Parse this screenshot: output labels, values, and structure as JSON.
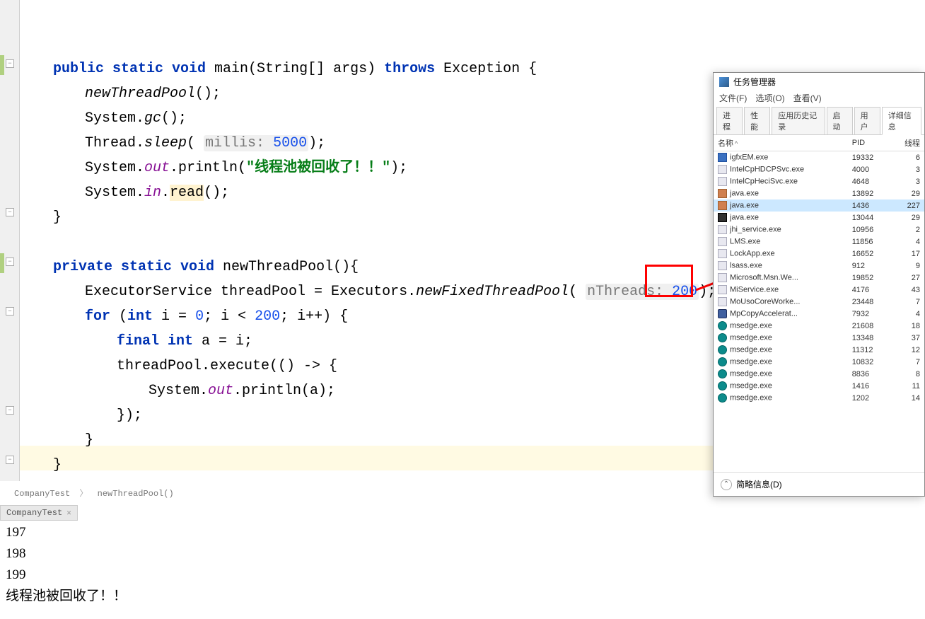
{
  "code": {
    "l1": "public static void",
    "l1_method": " main(String[] args) ",
    "l1_throws": "throws",
    "l1_exc": " Exception {",
    "l2_pre": "newThreadPool",
    "l2_post": "();",
    "l3_pre": "System.",
    "l3_gc": "gc",
    "l3_post": "();",
    "l4_pre": "Thread.",
    "l4_sleep": "sleep",
    "l4_open": "( ",
    "hint_millis": "millis:",
    "l4_num": " 5000",
    "l4_close": ");",
    "l5_pre": "System.",
    "l5_out": "out",
    "l5_print": ".println(",
    "l5_str": "\"线程池被回收了！！\"",
    "l5_close": ");",
    "l6_pre": "System.",
    "l6_in": "in",
    "l6_dot": ".",
    "l6_read": "read",
    "l6_close": "();",
    "l7": "}",
    "l8": "private static void",
    "l8_method": " newThreadPool(){",
    "l9_pre": "ExecutorService threadPool = Executors.",
    "l9_m": "newFixedThreadPool",
    "l9_open": "( ",
    "hint_nthreads": "nThreads:",
    "l9_num": " 200",
    "l9_close": ");",
    "l10_for": "for",
    "l10_open": " (",
    "l10_int": "int",
    "l10_i": " i = ",
    "l10_zero": "0",
    "l10_semi": "; i < ",
    "l10_lim": "200",
    "l10_inc": "; i++) {",
    "l11_final": "final int",
    "l11_rest": " a = i;",
    "l12": "threadPool.execute(() -> {",
    "l13_pre": "System.",
    "l13_out": "out",
    "l13_rest": ".println(a);",
    "l14": "});",
    "l15": "}",
    "l16": "}"
  },
  "breadcrumb": {
    "a": "CompanyTest",
    "b": "newThreadPool()"
  },
  "console_tab": "CompanyTest",
  "output": [
    "197",
    "198",
    "199",
    "线程池被回收了！！"
  ],
  "tm": {
    "title": "任务管理器",
    "menu": [
      "文件(F)",
      "选项(O)",
      "查看(V)"
    ],
    "tabs": [
      "进程",
      "性能",
      "应用历史记录",
      "启动",
      "用户",
      "详细信息"
    ],
    "cols": [
      "名称",
      "PID",
      "线程"
    ],
    "rows": [
      {
        "icon": "igfx",
        "name": "igfxEM.exe",
        "pid": "19332",
        "thr": "6"
      },
      {
        "icon": "gen",
        "name": "IntelCpHDCPSvc.exe",
        "pid": "4000",
        "thr": "3"
      },
      {
        "icon": "gen",
        "name": "IntelCpHeciSvc.exe",
        "pid": "4648",
        "thr": "3"
      },
      {
        "icon": "java",
        "name": "java.exe",
        "pid": "13892",
        "thr": "29"
      },
      {
        "icon": "java",
        "name": "java.exe",
        "pid": "1436",
        "thr": "227",
        "sel": true
      },
      {
        "icon": "jb",
        "name": "java.exe",
        "pid": "13044",
        "thr": "29"
      },
      {
        "icon": "gen",
        "name": "jhi_service.exe",
        "pid": "10956",
        "thr": "2"
      },
      {
        "icon": "gen",
        "name": "LMS.exe",
        "pid": "11856",
        "thr": "4"
      },
      {
        "icon": "gen",
        "name": "LockApp.exe",
        "pid": "16652",
        "thr": "17"
      },
      {
        "icon": "gen",
        "name": "lsass.exe",
        "pid": "912",
        "thr": "9"
      },
      {
        "icon": "gen",
        "name": "Microsoft.Msn.We...",
        "pid": "19852",
        "thr": "27"
      },
      {
        "icon": "gen",
        "name": "MiService.exe",
        "pid": "4176",
        "thr": "43"
      },
      {
        "icon": "gen",
        "name": "MoUsoCoreWorke...",
        "pid": "23448",
        "thr": "7"
      },
      {
        "icon": "shield",
        "name": "MpCopyAccelerat...",
        "pid": "7932",
        "thr": "4"
      },
      {
        "icon": "edge",
        "name": "msedge.exe",
        "pid": "21608",
        "thr": "18"
      },
      {
        "icon": "edge",
        "name": "msedge.exe",
        "pid": "13348",
        "thr": "37"
      },
      {
        "icon": "edge",
        "name": "msedge.exe",
        "pid": "11312",
        "thr": "12"
      },
      {
        "icon": "edge",
        "name": "msedge.exe",
        "pid": "10832",
        "thr": "7"
      },
      {
        "icon": "edge",
        "name": "msedge.exe",
        "pid": "8836",
        "thr": "8"
      },
      {
        "icon": "edge",
        "name": "msedge.exe",
        "pid": "1416",
        "thr": "11"
      },
      {
        "icon": "edge",
        "name": "msedge.exe",
        "pid": "1202",
        "thr": "14"
      }
    ],
    "footer": "简略信息(D)"
  }
}
